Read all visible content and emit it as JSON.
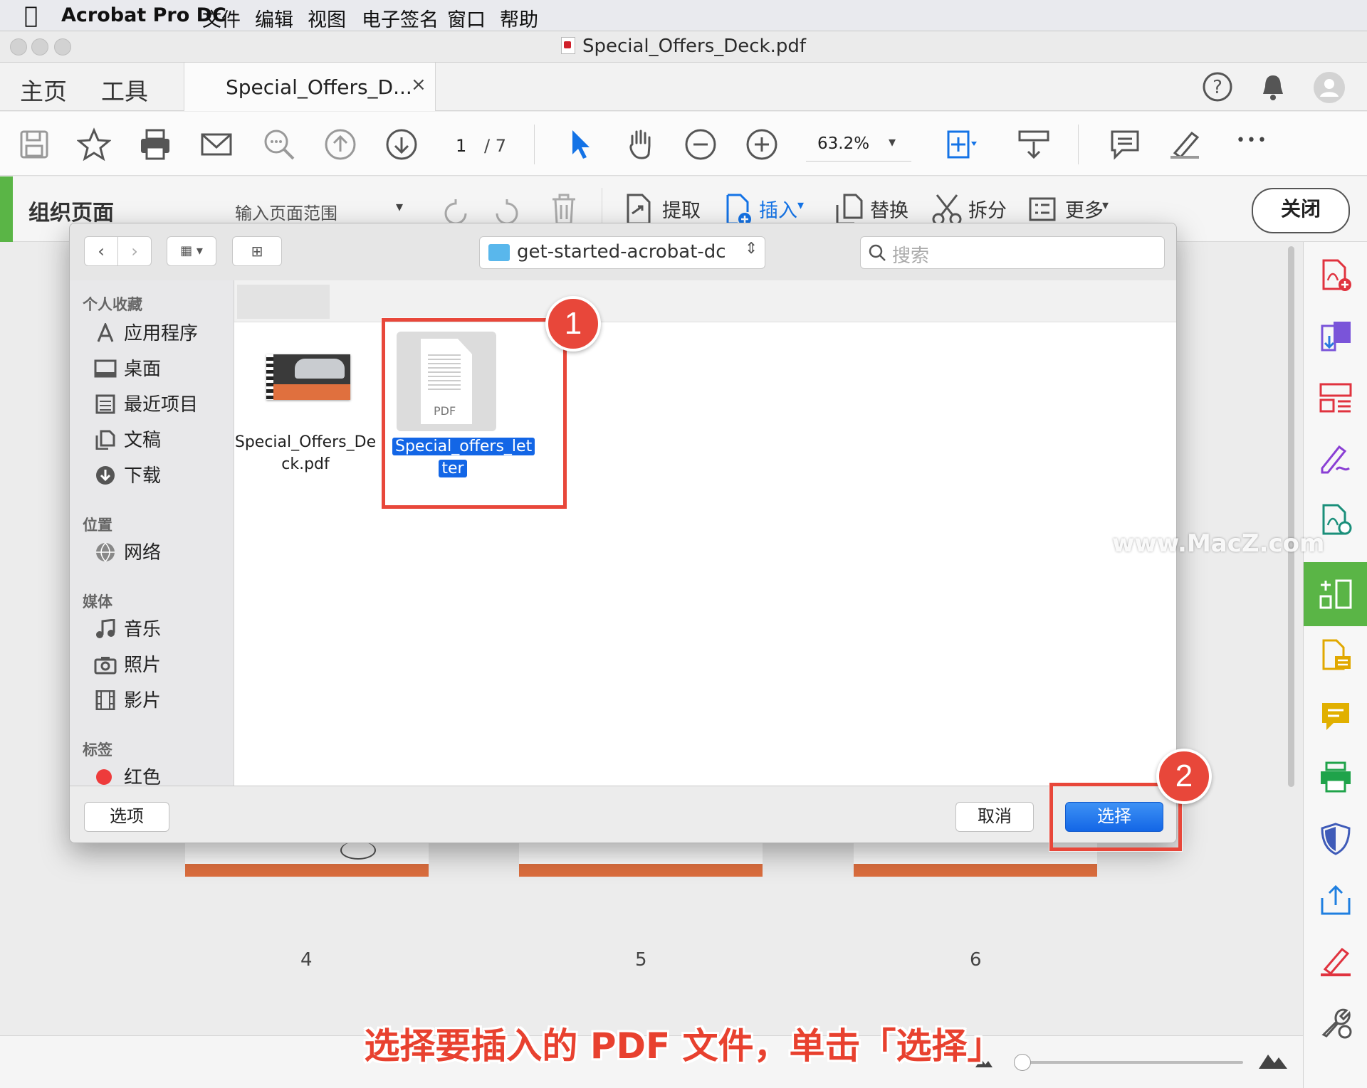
{
  "menubar": {
    "app_name": "Acrobat Pro DC",
    "items": [
      "文件",
      "编辑",
      "视图",
      "电子签名",
      "窗口",
      "帮助"
    ]
  },
  "window": {
    "title": "Special_Offers_Deck.pdf"
  },
  "tabs": {
    "home": "主页",
    "tools": "工具",
    "document": "Special_Offers_D...",
    "close_glyph": "×"
  },
  "toolbar": {
    "page_current": "1",
    "page_total": "/ 7",
    "zoom": "63.2%",
    "more_glyph": "•••"
  },
  "organize": {
    "title": "组织页面",
    "range_placeholder": "输入页面范围",
    "extract": "提取",
    "insert": "插入",
    "replace": "替换",
    "split": "拆分",
    "more": "更多",
    "close": "关闭"
  },
  "dialog": {
    "location": "get-started-acrobat-dc",
    "search_placeholder": "搜索",
    "sidebar": {
      "favorites_header": "个人收藏",
      "favorites": [
        "应用程序",
        "桌面",
        "最近项目",
        "文稿",
        "下载"
      ],
      "locations_header": "位置",
      "locations": [
        "网络"
      ],
      "media_header": "媒体",
      "media": [
        "音乐",
        "照片",
        "影片"
      ],
      "tags_header": "标签",
      "tags": [
        "红色"
      ]
    },
    "files": [
      {
        "name_line1": "Special_Offers_De",
        "name_line2": "ck.pdf",
        "selected": false
      },
      {
        "name_line1": "Special_offers_let",
        "name_line2": "ter",
        "selected": true,
        "thumb_label": "PDF"
      }
    ],
    "options_button": "选项",
    "cancel_button": "取消",
    "choose_button": "选择"
  },
  "pages": {
    "labels": [
      "4",
      "5",
      "6"
    ]
  },
  "annotations": {
    "badge1": "1",
    "badge2": "2"
  },
  "caption": "选择要插入的 PDF 文件，单击「选择」",
  "watermark": "www.MacZ.com",
  "colors": {
    "accent_green": "#5ab546",
    "selection_blue": "#1366e6",
    "callout_red": "#e8473a"
  }
}
